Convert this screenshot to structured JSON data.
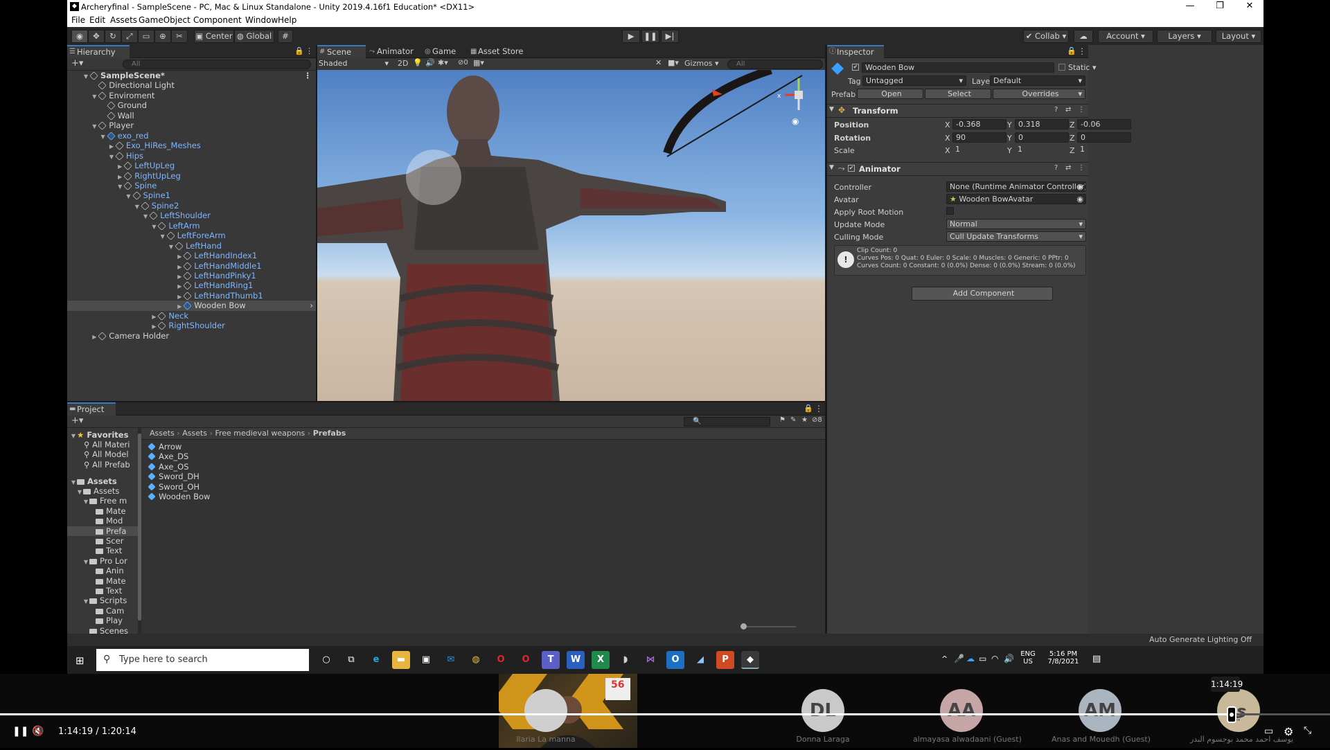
{
  "window": {
    "title": "Archeryfinal - SampleScene - PC, Mac & Linux Standalone - Unity 2019.4.16f1 Education* <DX11>"
  },
  "menu": [
    "File",
    "Edit",
    "Assets",
    "GameObject",
    "Component",
    "Window",
    "Help"
  ],
  "toolbar": {
    "center": "Center",
    "global": "Global",
    "collab": "Collab",
    "account": "Account",
    "layers": "Layers",
    "layout": "Layout"
  },
  "hierarchy": {
    "tab": "Hierarchy",
    "search_placeholder": "All",
    "rows": [
      {
        "label": "SampleScene*",
        "depth": 0,
        "arrow": "▼",
        "icon": "scene",
        "style": "bold"
      },
      {
        "label": "Directional Light",
        "depth": 1,
        "arrow": "",
        "icon": "go"
      },
      {
        "label": "Enviroment",
        "depth": 1,
        "arrow": "▼",
        "icon": "go"
      },
      {
        "label": "Ground",
        "depth": 2,
        "arrow": "",
        "icon": "go"
      },
      {
        "label": "Wall",
        "depth": 2,
        "arrow": "",
        "icon": "go"
      },
      {
        "label": "Player",
        "depth": 1,
        "arrow": "▼",
        "icon": "go"
      },
      {
        "label": "exo_red",
        "depth": 2,
        "arrow": "▼",
        "icon": "prefab",
        "style": "blue"
      },
      {
        "label": "Exo_HiRes_Meshes",
        "depth": 3,
        "arrow": "▶",
        "icon": "go",
        "style": "blue"
      },
      {
        "label": "Hips",
        "depth": 3,
        "arrow": "▼",
        "icon": "go",
        "style": "blue"
      },
      {
        "label": "LeftUpLeg",
        "depth": 4,
        "arrow": "▶",
        "icon": "go",
        "style": "blue"
      },
      {
        "label": "RightUpLeg",
        "depth": 4,
        "arrow": "▶",
        "icon": "go",
        "style": "blue"
      },
      {
        "label": "Spine",
        "depth": 4,
        "arrow": "▼",
        "icon": "go",
        "style": "blue"
      },
      {
        "label": "Spine1",
        "depth": 5,
        "arrow": "▼",
        "icon": "go",
        "style": "blue"
      },
      {
        "label": "Spine2",
        "depth": 6,
        "arrow": "▼",
        "icon": "go",
        "style": "blue"
      },
      {
        "label": "LeftShoulder",
        "depth": 7,
        "arrow": "▼",
        "icon": "go",
        "style": "blue"
      },
      {
        "label": "LeftArm",
        "depth": 8,
        "arrow": "▼",
        "icon": "go",
        "style": "blue"
      },
      {
        "label": "LeftForeArm",
        "depth": 9,
        "arrow": "▼",
        "icon": "go",
        "style": "blue"
      },
      {
        "label": "LeftHand",
        "depth": 10,
        "arrow": "▼",
        "icon": "go",
        "style": "blue"
      },
      {
        "label": "LeftHandIndex1",
        "depth": 11,
        "arrow": "▶",
        "icon": "go",
        "style": "blue"
      },
      {
        "label": "LeftHandMiddle1",
        "depth": 11,
        "arrow": "▶",
        "icon": "go",
        "style": "blue"
      },
      {
        "label": "LeftHandPinky1",
        "depth": 11,
        "arrow": "▶",
        "icon": "go",
        "style": "blue"
      },
      {
        "label": "LeftHandRing1",
        "depth": 11,
        "arrow": "▶",
        "icon": "go",
        "style": "blue"
      },
      {
        "label": "LeftHandThumb1",
        "depth": 11,
        "arrow": "▶",
        "icon": "go",
        "style": "blue"
      },
      {
        "label": "Wooden Bow",
        "depth": 11,
        "arrow": "▶",
        "icon": "prefab",
        "style": "selrow"
      },
      {
        "label": "Neck",
        "depth": 8,
        "arrow": "▶",
        "icon": "go",
        "style": "blue"
      },
      {
        "label": "RightShoulder",
        "depth": 8,
        "arrow": "▶",
        "icon": "go",
        "style": "blue"
      },
      {
        "label": "Camera Holder",
        "depth": 1,
        "arrow": "▶",
        "icon": "go"
      }
    ]
  },
  "scene": {
    "tabs": [
      "Scene",
      "Animator",
      "Game",
      "Asset Store"
    ],
    "shading": "Shaded",
    "mode2d": "2D",
    "fx_count": "0",
    "gizmos": "Gizmos",
    "search_placeholder": "All"
  },
  "inspector": {
    "tab": "Inspector",
    "object_name": "Wooden Bow",
    "static_label": "Static",
    "tag_label": "Tag",
    "tag_value": "Untagged",
    "layer_label": "Layer",
    "layer_value": "Default",
    "prefab_label": "Prefab",
    "open": "Open",
    "select": "Select",
    "overrides": "Overrides",
    "transform": {
      "title": "Transform",
      "position_label": "Position",
      "rotation_label": "Rotation",
      "scale_label": "Scale",
      "pos": [
        "-0.368",
        "0.318",
        "-0.06"
      ],
      "rot": [
        "90",
        "0",
        "0"
      ],
      "scale": [
        "1",
        "1",
        "1"
      ],
      "axes": [
        "X",
        "Y",
        "Z"
      ]
    },
    "animator": {
      "title": "Animator",
      "controller_label": "Controller",
      "controller_value": "None (Runtime Animator Controller)",
      "avatar_label": "Avatar",
      "avatar_value": "Wooden BowAvatar",
      "root_motion_label": "Apply Root Motion",
      "update_mode_label": "Update Mode",
      "update_mode_value": "Normal",
      "culling_label": "Culling Mode",
      "culling_value": "Cull Update Transforms",
      "info1": "Clip Count: 0",
      "info2": "Curves Pos: 0 Quat: 0 Euler: 0 Scale: 0 Muscles: 0 Generic: 0 PPtr: 0",
      "info3": "Curves Count: 0 Constant: 0 (0.0%) Dense: 0 (0.0%) Stream: 0 (0.0%)"
    },
    "add_component": "Add Component"
  },
  "project": {
    "tab": "Project",
    "hidden_count": "8",
    "breadcrumb": [
      "Assets",
      "Assets",
      "Free medieval weapons",
      "Prefabs"
    ],
    "favorites_title": "Favorites",
    "favorites": [
      "All Materi",
      "All Model",
      "All Prefab"
    ],
    "tree_title": "Assets",
    "tree": [
      {
        "label": "Assets",
        "depth": 1,
        "arrow": "▼"
      },
      {
        "label": "Free m",
        "depth": 2,
        "arrow": "▼"
      },
      {
        "label": "Mate",
        "depth": 3,
        "arrow": ""
      },
      {
        "label": "Mod",
        "depth": 3,
        "arrow": ""
      },
      {
        "label": "Prefa",
        "depth": 3,
        "arrow": "",
        "sel": true
      },
      {
        "label": "Scer",
        "depth": 3,
        "arrow": ""
      },
      {
        "label": "Text",
        "depth": 3,
        "arrow": ""
      },
      {
        "label": "Pro Lor",
        "depth": 2,
        "arrow": "▼"
      },
      {
        "label": "Anin",
        "depth": 3,
        "arrow": ""
      },
      {
        "label": "Mate",
        "depth": 3,
        "arrow": ""
      },
      {
        "label": "Text",
        "depth": 3,
        "arrow": ""
      },
      {
        "label": "Scripts",
        "depth": 2,
        "arrow": "▼"
      },
      {
        "label": "Cam",
        "depth": 3,
        "arrow": ""
      },
      {
        "label": "Play",
        "depth": 3,
        "arrow": ""
      },
      {
        "label": "Scenes",
        "depth": 2,
        "arrow": ""
      }
    ],
    "assets": [
      "Arrow",
      "Axe_DS",
      "Axe_OS",
      "Sword_DH",
      "Sword_OH",
      "Wooden Bow"
    ]
  },
  "status": {
    "lighting": "Auto Generate Lighting Off"
  },
  "taskbar": {
    "search_placeholder": "Type here to search",
    "lang": "ENG",
    "region": "US",
    "time": "5:16 PM",
    "date": "7/8/2021"
  },
  "video": {
    "current": "1:14:19",
    "separator": "/",
    "total": "1:20:14",
    "tooltip": "1:14:19",
    "progress": 0.926,
    "participants": [
      {
        "name": "Ilaria La manna",
        "initials": ""
      },
      {
        "name": "Donna Laraga",
        "initials": "DL"
      },
      {
        "name": "almayasa alwadaani (Guest)",
        "initials": "AA"
      },
      {
        "name": "Anas and Mouedh (Guest)",
        "initials": "AM"
      },
      {
        "name": "يوسف احمد محمد بوجسوم البدر",
        "initials": "ي"
      }
    ]
  },
  "colors": {
    "selection": "#3a79bb",
    "link_blue": "#7fb6ff",
    "unity_bg": "#383838"
  }
}
